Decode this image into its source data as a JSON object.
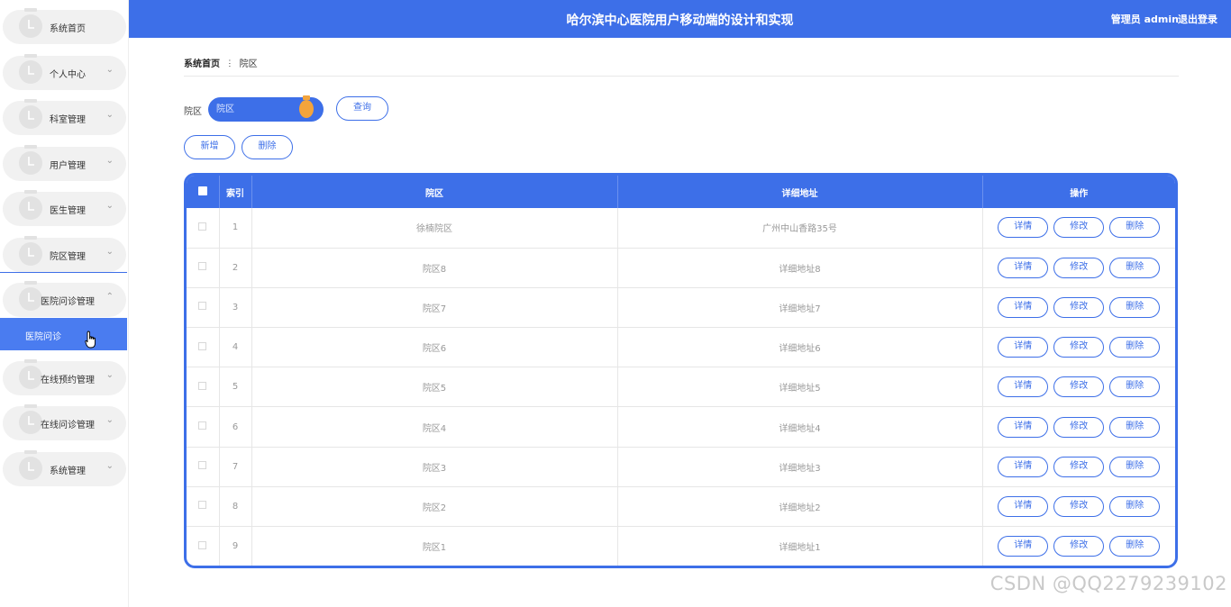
{
  "app": {
    "title": "哈尔滨中心医院用户移动端的设计和实现",
    "user_label": "管理员 admin",
    "logout_label": "退出登录"
  },
  "sidebar": {
    "items": [
      {
        "label": "系统首页",
        "chevron": false
      },
      {
        "label": "个人中心",
        "chevron": true
      },
      {
        "label": "科室管理",
        "chevron": true
      },
      {
        "label": "用户管理",
        "chevron": true
      },
      {
        "label": "医生管理",
        "chevron": true
      },
      {
        "label": "院区管理",
        "chevron": true
      },
      {
        "label": "医院问诊管理",
        "chevron": true,
        "expanded": true
      },
      {
        "label": "在线预约管理",
        "chevron": true
      },
      {
        "label": "在线问诊管理",
        "chevron": true
      },
      {
        "label": "系统管理",
        "chevron": true
      }
    ],
    "active_sub": "医院问诊"
  },
  "breadcrumb": {
    "home": "系统首页",
    "separator": "ⵗ",
    "current": "院区"
  },
  "search": {
    "label": "院区",
    "placeholder": "院区",
    "query_button": "查询"
  },
  "actions": {
    "add_button": "新增",
    "delete_button": "删除"
  },
  "table": {
    "headers": [
      "索引",
      "院区",
      "详细地址",
      "操作"
    ],
    "rows": [
      {
        "index": "1",
        "campus": "徐楠院区",
        "address": "广州中山香路35号"
      },
      {
        "index": "2",
        "campus": "院区8",
        "address": "详细地址8"
      },
      {
        "index": "3",
        "campus": "院区7",
        "address": "详细地址7"
      },
      {
        "index": "4",
        "campus": "院区6",
        "address": "详细地址6"
      },
      {
        "index": "5",
        "campus": "院区5",
        "address": "详细地址5"
      },
      {
        "index": "6",
        "campus": "院区4",
        "address": "详细地址4"
      },
      {
        "index": "7",
        "campus": "院区3",
        "address": "详细地址3"
      },
      {
        "index": "8",
        "campus": "院区2",
        "address": "详细地址2"
      },
      {
        "index": "9",
        "campus": "院区1",
        "address": "详细地址1"
      }
    ],
    "row_actions": {
      "detail": "详情",
      "edit": "修改",
      "delete": "删除"
    }
  },
  "watermark": "CSDN @QQ2279239102",
  "colors": {
    "primary": "#3d6fe8",
    "accent": "#f3a43c",
    "menu_bg": "#f1f1f1"
  }
}
